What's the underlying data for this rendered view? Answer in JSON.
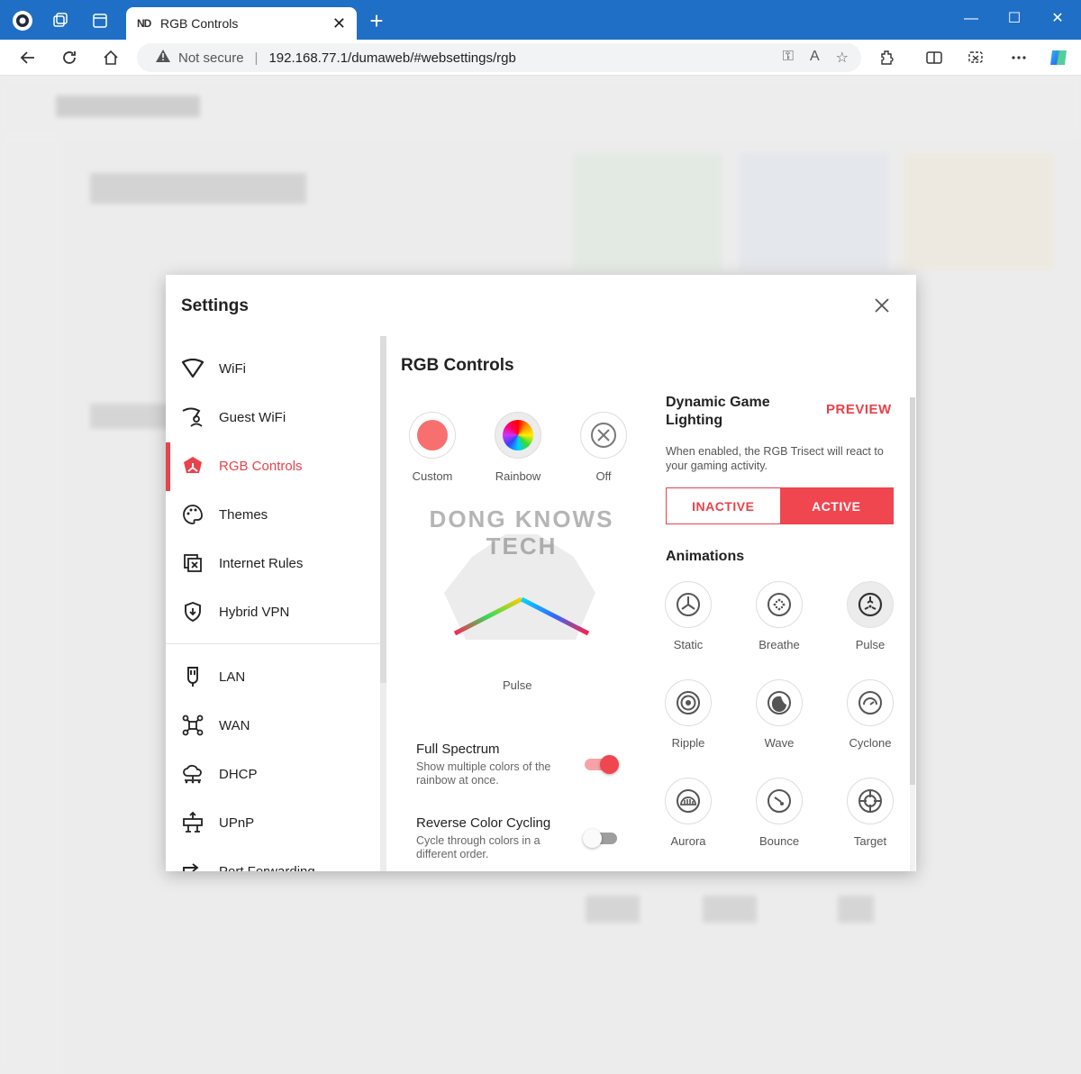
{
  "browser": {
    "tab_favicon": "ND",
    "tab_title": "RGB Controls",
    "security_label": "Not secure",
    "url": "192.168.77.1/dumaweb/#websettings/rgb"
  },
  "modal": {
    "title": "Settings",
    "sidebar": {
      "items": [
        {
          "label": "WiFi",
          "icon": "wifi-icon"
        },
        {
          "label": "Guest WiFi",
          "icon": "guest-wifi-icon"
        },
        {
          "label": "RGB Controls",
          "icon": "rgb-trisect-icon",
          "active": true
        },
        {
          "label": "Themes",
          "icon": "palette-icon"
        },
        {
          "label": "Internet Rules",
          "icon": "internet-rules-icon"
        },
        {
          "label": "Hybrid VPN",
          "icon": "shield-icon"
        },
        {
          "label": "LAN",
          "icon": "lan-plug-icon"
        },
        {
          "label": "WAN",
          "icon": "wan-network-icon"
        },
        {
          "label": "DHCP",
          "icon": "dhcp-cloud-icon"
        },
        {
          "label": "UPnP",
          "icon": "upnp-icon"
        },
        {
          "label": "Port Forwarding",
          "icon": "port-forwarding-icon"
        }
      ]
    },
    "content": {
      "title": "RGB Controls",
      "modes": [
        {
          "label": "Custom",
          "color": "#f7706f"
        },
        {
          "label": "Rainbow"
        },
        {
          "label": "Off"
        }
      ],
      "preview_label": "Pulse",
      "watermark": "DONG KNOWS TECH",
      "full_spectrum": {
        "title": "Full Spectrum",
        "description": "Show multiple colors of the rainbow at once.",
        "enabled": true
      },
      "reverse_cycling": {
        "title": "Reverse Color Cycling",
        "description": "Cycle through colors in a different order.",
        "enabled": false
      },
      "dynamic": {
        "title": "Dynamic Game Lighting",
        "preview_link": "PREVIEW",
        "description": "When enabled, the RGB Trisect will react to your gaming activity.",
        "inactive_label": "INACTIVE",
        "active_label": "ACTIVE"
      },
      "animations": {
        "title": "Animations",
        "items": [
          {
            "label": "Static"
          },
          {
            "label": "Breathe"
          },
          {
            "label": "Pulse",
            "selected": true
          },
          {
            "label": "Ripple"
          },
          {
            "label": "Wave"
          },
          {
            "label": "Cyclone"
          },
          {
            "label": "Aurora"
          },
          {
            "label": "Bounce"
          },
          {
            "label": "Target"
          }
        ]
      }
    }
  },
  "colors": {
    "accent": "#e8424b",
    "titlebar": "#1f6fc6"
  }
}
